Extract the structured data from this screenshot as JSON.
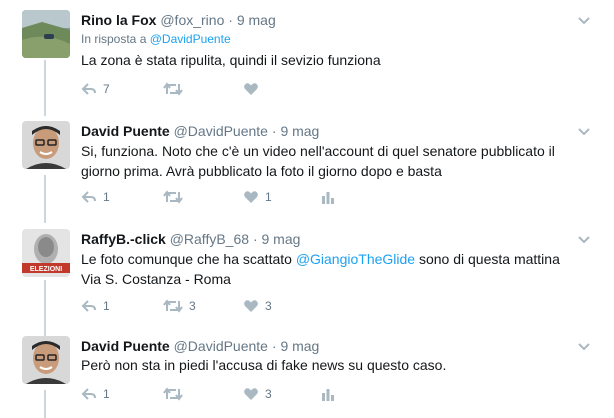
{
  "colors": {
    "link": "#1da1f2",
    "muted": "#657786",
    "icon": "#aab8c2",
    "line": "#ccd6dd"
  },
  "icons": [
    "reply-icon",
    "retweet-icon",
    "like-icon",
    "analytics-icon",
    "chevron-down-icon"
  ],
  "tweets": [
    {
      "name": "Rino la Fox",
      "handle": "@fox_rino",
      "time": "9 mag",
      "reply_prefix": "In risposta a",
      "reply_to": "@DavidPuente",
      "text": "La zona è stata ripulita, quindi il sevizio funziona",
      "reply_count": "7",
      "retweet_count": "",
      "like_count": ""
    },
    {
      "name": "David Puente",
      "handle": "@DavidPuente",
      "time": "9 mag",
      "text_line1": "Si, funziona. Noto che c'è un video nell'account di quel senatore pubblicato il",
      "text_line2": "giorno prima. Avrà pubblicato la foto il giorno dopo e basta",
      "reply_count": "1",
      "retweet_count": "",
      "like_count": "1"
    },
    {
      "name": "RaffyB.-click",
      "handle": "@RaffyB_68",
      "time": "9 mag",
      "text_before": "Le foto comunque che ha scattato ",
      "text_mention": "@GiangioTheGlide",
      "text_after": " sono di questa mattina",
      "text_line2": "Via S. Costanza - Roma",
      "reply_count": "1",
      "retweet_count": "3",
      "like_count": "3"
    },
    {
      "name": "David Puente",
      "handle": "@DavidPuente",
      "time": "9 mag",
      "text": "Però non sta in piedi l'accusa di fake news su questo caso.",
      "reply_count": "1",
      "retweet_count": "",
      "like_count": "3"
    }
  ]
}
